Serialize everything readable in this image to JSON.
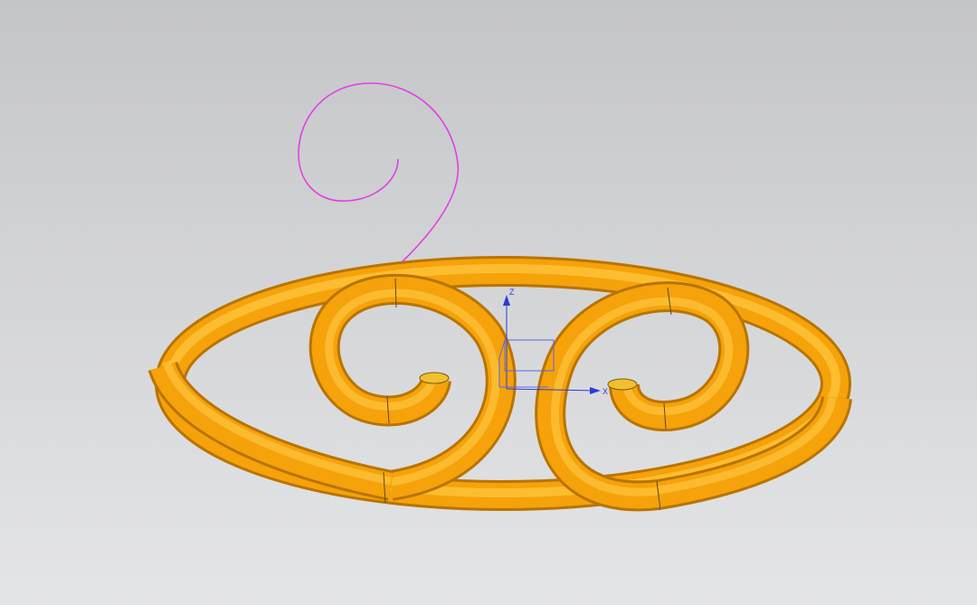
{
  "viewport": {
    "background_top": "#c4c5c8",
    "background_bottom": "#e4e5e7"
  },
  "model": {
    "tube_color": "#f5a20b",
    "tube_shadow": "#c97c00",
    "tube_highlight": "#ffd45a",
    "seam_color": "#5a4a1c"
  },
  "curves": {
    "guide_curve_color": "#e040e0",
    "base_curve_color": "#3a3ae0"
  },
  "triad": {
    "color": "#2a3ad8",
    "z_label": "Z",
    "x_label": "X"
  }
}
